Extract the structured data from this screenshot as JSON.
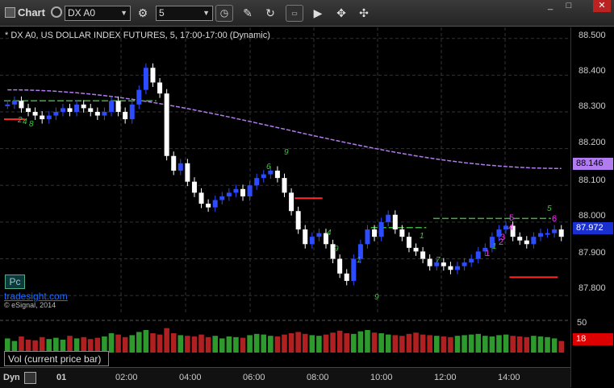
{
  "toolbar": {
    "title": "Chart",
    "symbol": "DX A0",
    "interval": "5",
    "buttons": [
      "clock-icon",
      "pencil-icon",
      "refresh-icon",
      "studies-icon",
      "play-icon",
      "drawing-tools-icon"
    ]
  },
  "chart": {
    "description": "* DX A0, US DOLLAR INDEX FUTURES, 5, 17:00-17:00 (Dynamic)",
    "brand": "tradesight.com",
    "copyright": "© eSignal, 2014",
    "pc_label": "Pc",
    "colors": {
      "up": "#2d4bff",
      "down": "#ffffff",
      "ma": "#b07cf0",
      "support": "#ff2a2a",
      "resistance": "#3cb43c",
      "count": "#3cc83c",
      "magenta": "#ff2bff"
    }
  },
  "price_axis": {
    "labels": [
      "88.500",
      "88.400",
      "88.300",
      "88.200",
      "88.100",
      "88.000",
      "87.900",
      "87.800"
    ],
    "ma_value": "88.146",
    "last_price": "87.972"
  },
  "volume": {
    "label": "Vol (current price bar)",
    "axis_top": "50",
    "current": "18"
  },
  "time_axis": {
    "prefix": "Dyn",
    "labels": [
      "01",
      "02:00",
      "04:00",
      "06:00",
      "08:00",
      "10:00",
      "12:00",
      "14:00"
    ]
  },
  "annotations": {
    "magenta": [
      "1",
      "2",
      "3",
      "4",
      "5",
      "6"
    ],
    "green": [
      "1",
      "2",
      "3",
      "4",
      "5",
      "6",
      "7",
      "8",
      "9"
    ]
  },
  "chart_data": {
    "type": "candlestick",
    "title": "DX A0, US DOLLAR INDEX FUTURES, 5",
    "ylim": [
      87.75,
      88.53
    ],
    "ma_start": 88.36,
    "ma_end": 88.146,
    "closes": [
      88.32,
      88.33,
      88.31,
      88.3,
      88.29,
      88.28,
      88.29,
      88.3,
      88.31,
      88.3,
      88.32,
      88.31,
      88.3,
      88.29,
      88.3,
      88.33,
      88.3,
      88.28,
      88.32,
      88.36,
      88.42,
      88.38,
      88.35,
      88.18,
      88.14,
      88.16,
      88.11,
      88.08,
      88.05,
      88.04,
      88.06,
      88.07,
      88.08,
      88.09,
      88.07,
      88.1,
      88.12,
      88.13,
      88.14,
      88.12,
      88.08,
      88.03,
      87.98,
      87.94,
      87.96,
      87.97,
      87.94,
      87.9,
      87.86,
      87.84,
      87.9,
      87.94,
      87.98,
      87.96,
      88.0,
      88.02,
      87.98,
      87.96,
      87.93,
      87.92,
      87.9,
      87.88,
      87.89,
      87.88,
      87.87,
      87.88,
      87.89,
      87.9,
      87.92,
      87.93,
      87.96,
      87.98,
      87.99,
      87.96,
      87.95,
      87.94,
      87.96,
      87.97,
      87.97,
      87.98,
      87.96
    ],
    "volume": [
      22,
      18,
      25,
      20,
      19,
      24,
      21,
      23,
      20,
      26,
      22,
      24,
      21,
      23,
      25,
      30,
      28,
      24,
      27,
      32,
      35,
      30,
      28,
      38,
      30,
      27,
      26,
      25,
      28,
      24,
      26,
      22,
      25,
      24,
      23,
      27,
      29,
      28,
      26,
      25,
      28,
      30,
      32,
      29,
      27,
      26,
      28,
      31,
      34,
      30,
      29,
      33,
      35,
      31,
      30,
      28,
      27,
      26,
      29,
      31,
      28,
      27,
      26,
      25,
      24,
      26,
      27,
      28,
      29,
      26,
      25,
      27,
      28,
      26,
      25,
      24,
      26,
      25,
      24,
      22,
      18
    ],
    "support_lines": [
      {
        "price": 88.28,
        "x0": 0,
        "x1": 3
      },
      {
        "price": 88.065,
        "x0": 42,
        "x1": 46
      },
      {
        "price": 87.85,
        "x0": 73,
        "x1": 80
      }
    ],
    "resistance_lines": [
      {
        "price": 88.33,
        "x0": 0,
        "x1": 22
      },
      {
        "price": 87.985,
        "x0": 53,
        "x1": 61
      },
      {
        "price": 88.01,
        "x0": 62,
        "x1": 79
      }
    ]
  }
}
